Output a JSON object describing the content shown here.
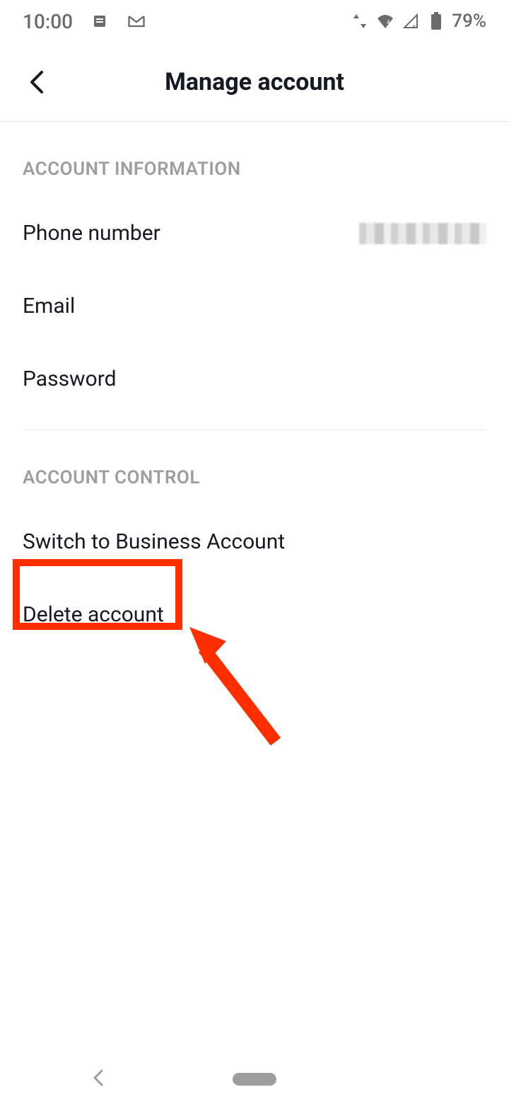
{
  "status_bar": {
    "time": "10:00",
    "battery": "79%"
  },
  "header": {
    "title": "Manage account"
  },
  "sections": {
    "account_info": {
      "header": "ACCOUNT INFORMATION",
      "items": {
        "phone": {
          "label": "Phone number"
        },
        "email": {
          "label": "Email"
        },
        "password": {
          "label": "Password"
        }
      }
    },
    "account_control": {
      "header": "ACCOUNT CONTROL",
      "items": {
        "switch": {
          "label": "Switch to Business Account"
        },
        "delete": {
          "label": "Delete account"
        }
      }
    }
  }
}
